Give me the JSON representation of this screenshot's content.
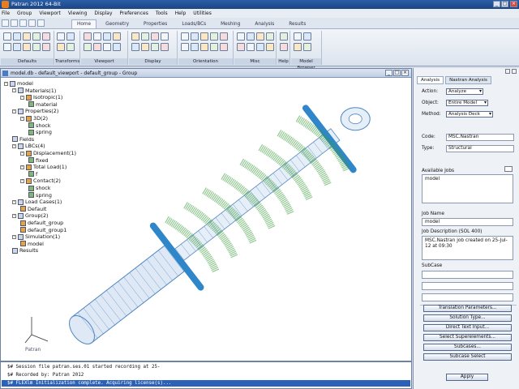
{
  "app": {
    "title": "Patran 2012 64-Bit"
  },
  "menu": [
    "File",
    "Group",
    "Viewport",
    "Viewing",
    "Display",
    "Preferences",
    "Tools",
    "Help",
    "Utilities"
  ],
  "ribbon": {
    "tabs": [
      "Home",
      "Geometry",
      "Properties",
      "Loads/BCs",
      "Meshing",
      "Analysis",
      "Results"
    ],
    "active_tab": "Home",
    "groups": [
      "Defaults",
      "Transforms",
      "Viewport",
      "Display",
      "Orientation",
      "Misc",
      "Help",
      "Model Browser"
    ]
  },
  "viewport": {
    "title": "model.db - default_viewport - default_group - Group",
    "axis_label": "Patran"
  },
  "tree": [
    {
      "label": "model",
      "level": 0,
      "toggle": "-"
    },
    {
      "label": "Materials(1)",
      "level": 1,
      "toggle": "-"
    },
    {
      "label": "Isotropic(1)",
      "level": 2,
      "toggle": "-"
    },
    {
      "label": "material",
      "level": 3,
      "toggle": ""
    },
    {
      "label": "Properties(2)",
      "level": 1,
      "toggle": "-"
    },
    {
      "label": "3D(2)",
      "level": 2,
      "toggle": "-"
    },
    {
      "label": "shock",
      "level": 3,
      "toggle": ""
    },
    {
      "label": "spring",
      "level": 3,
      "toggle": ""
    },
    {
      "label": "Fields",
      "level": 1,
      "toggle": ""
    },
    {
      "label": "LBCs(4)",
      "level": 1,
      "toggle": "-"
    },
    {
      "label": "Displacement(1)",
      "level": 2,
      "toggle": "-"
    },
    {
      "label": "fixed",
      "level": 3,
      "toggle": ""
    },
    {
      "label": "Total Load(1)",
      "level": 2,
      "toggle": "-"
    },
    {
      "label": "f",
      "level": 3,
      "toggle": ""
    },
    {
      "label": "Contact(2)",
      "level": 2,
      "toggle": "-"
    },
    {
      "label": "shock",
      "level": 3,
      "toggle": ""
    },
    {
      "label": "spring",
      "level": 3,
      "toggle": ""
    },
    {
      "label": "Load Cases(1)",
      "level": 1,
      "toggle": "-"
    },
    {
      "label": "Default",
      "level": 2,
      "toggle": ""
    },
    {
      "label": "Group(2)",
      "level": 1,
      "toggle": "-"
    },
    {
      "label": "default_group",
      "level": 2,
      "toggle": ""
    },
    {
      "label": "default_group1",
      "level": 2,
      "toggle": ""
    },
    {
      "label": "Simulation(1)",
      "level": 1,
      "toggle": "-"
    },
    {
      "label": "model",
      "level": 2,
      "toggle": ""
    },
    {
      "label": "Results",
      "level": 1,
      "toggle": ""
    }
  ],
  "history": [
    {
      "text": "$# Session file patran.ses.01 started recording at 25-",
      "selected": false
    },
    {
      "text": "$# Recorded by: Patran 2012",
      "selected": false
    },
    {
      "text": "$# FLEXlm Initialization complete. Acquiring license(s)...",
      "selected": true
    }
  ],
  "panel": {
    "tabs": [
      "Analysis",
      "Nastran Analysis"
    ],
    "action_label": "Action:",
    "action_value": "Analyze",
    "object_label": "Object:",
    "object_value": "Entire Model",
    "method_label": "Method:",
    "method_value": "Analysis Deck",
    "code_label": "Code:",
    "code_value": "MSC.Nastran",
    "type_label": "Type:",
    "type_value": "Structural",
    "job_list_label": "Available Jobs",
    "job_list_value": "model",
    "job_name_label": "Job Name",
    "job_name_value": "model",
    "job_desc_label": "Job Description (SOL 400)",
    "job_desc_value": "MSC.Nastran job created on 25-Jul-12 at 09:30",
    "subcase_label": "SubCase",
    "subcase_value": "",
    "buttons": [
      "Translation Parameters...",
      "Solution Type...",
      "Direct Text Input...",
      "Select Superelements...",
      "Subcases...",
      "Subcase Select"
    ],
    "apply_label": "Apply"
  },
  "colors": {
    "spring": "#3a9a3a",
    "shock": "#4f86c2",
    "plate": "#2f86c9"
  }
}
